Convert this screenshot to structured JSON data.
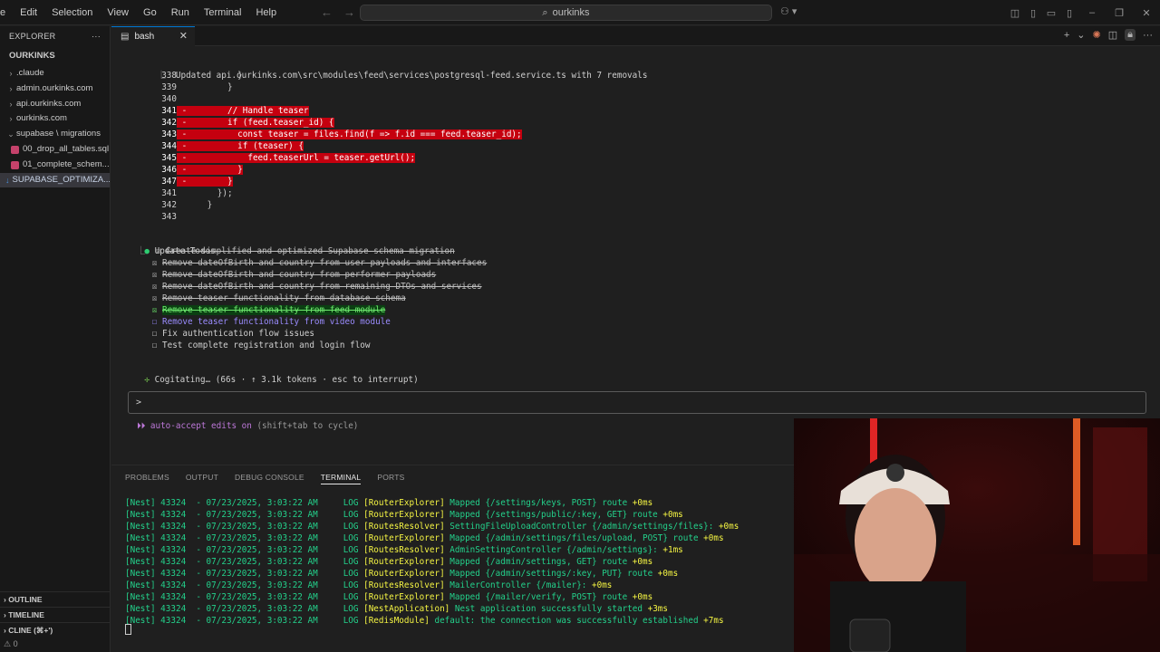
{
  "menu": [
    "e",
    "Edit",
    "Selection",
    "View",
    "Go",
    "Run",
    "Terminal",
    "Help"
  ],
  "search": {
    "text": "ourkinks"
  },
  "sidebar": {
    "title": "EXPLORER",
    "root": "OURKINKS",
    "items": [
      {
        "label": ".claude",
        "type": "folder"
      },
      {
        "label": "admin.ourkinks.com",
        "type": "folder"
      },
      {
        "label": "api.ourkinks.com",
        "type": "folder"
      },
      {
        "label": "ourkinks.com",
        "type": "folder"
      },
      {
        "label": "supabase \\ migrations",
        "type": "folder-open"
      },
      {
        "label": "00_drop_all_tables.sql",
        "type": "file"
      },
      {
        "label": "01_complete_schem...",
        "type": "file"
      },
      {
        "label": "SUPABASE_OPTIMIZA...",
        "type": "file-selected"
      }
    ],
    "outline": "OUTLINE",
    "timeline": "TIMELINE",
    "cline": "CLINE (⌘+')",
    "status": "⚠ 0"
  },
  "tab": {
    "label": "bash"
  },
  "editor": {
    "update_line": "Updated api.ourkinks.com\\src\\modules\\feed\\services\\postgresql-feed.service.ts with 7 removals",
    "code": [
      {
        "n": "338",
        "code": "        }",
        "del": false
      },
      {
        "n": "339",
        "code": "      }",
        "del": false
      },
      {
        "n": "340",
        "code": "",
        "del": false
      },
      {
        "n": "341",
        "code": "      // Handle teaser",
        "del": true
      },
      {
        "n": "342",
        "code": "      if (feed.teaser_id) {",
        "del": true
      },
      {
        "n": "343",
        "code": "        const teaser = files.find(f => f.id === feed.teaser_id);",
        "del": true
      },
      {
        "n": "344",
        "code": "        if (teaser) {",
        "del": true
      },
      {
        "n": "345",
        "code": "          feed.teaserUrl = teaser.getUrl();",
        "del": true
      },
      {
        "n": "346",
        "code": "        }",
        "del": true
      },
      {
        "n": "347",
        "code": "      }",
        "del": true
      },
      {
        "n": "341",
        "code": "    });",
        "del": false
      },
      {
        "n": "342",
        "code": "  }",
        "del": false
      },
      {
        "n": "343",
        "code": "",
        "del": false
      }
    ],
    "todos_title": "Update Todos",
    "todos": [
      {
        "text": "Create simplified and optimized Supabase schema migration",
        "state": "done"
      },
      {
        "text": "Remove dateOfBirth and country from user payloads and interfaces",
        "state": "done"
      },
      {
        "text": "Remove dateOfBirth and country from performer payloads",
        "state": "done"
      },
      {
        "text": "Remove dateOfBirth and country from remaining DTOs and services",
        "state": "done"
      },
      {
        "text": "Remove teaser functionality from database schema",
        "state": "done"
      },
      {
        "text": "Remove teaser functionality from feed module",
        "state": "just-done"
      },
      {
        "text": "Remove teaser functionality from video module",
        "state": "in-progress"
      },
      {
        "text": "Fix authentication flow issues",
        "state": "pending"
      },
      {
        "text": "Test complete registration and login flow",
        "state": "pending"
      }
    ],
    "cogitating": "Cogitating… (66s · ↑ 3.1k tokens · esc to interrupt)",
    "prompt_symbol": ">",
    "auto_accept": "⏵⏵ auto-accept edits on",
    "auto_accept_hint": "(shift+tab to cycle)"
  },
  "panel": {
    "tabs": [
      "PROBLEMS",
      "OUTPUT",
      "DEBUG CONSOLE",
      "TERMINAL",
      "PORTS"
    ],
    "active_tab": "TERMINAL",
    "logs": [
      {
        "ctx": "[RouterExplorer]",
        "msg": "Mapped {/settings/keys, POST} route",
        "t": "+0ms"
      },
      {
        "ctx": "[RouterExplorer]",
        "msg": "Mapped {/settings/public/:key, GET} route",
        "t": "+0ms"
      },
      {
        "ctx": "[RoutesResolver]",
        "msg": "SettingFileUploadController {/admin/settings/files}:",
        "t": "+0ms"
      },
      {
        "ctx": "[RouterExplorer]",
        "msg": "Mapped {/admin/settings/files/upload, POST} route",
        "t": "+0ms"
      },
      {
        "ctx": "[RoutesResolver]",
        "msg": "AdminSettingController {/admin/settings}:",
        "t": "+1ms"
      },
      {
        "ctx": "[RouterExplorer]",
        "msg": "Mapped {/admin/settings, GET} route",
        "t": "+0ms"
      },
      {
        "ctx": "[RouterExplorer]",
        "msg": "Mapped {/admin/settings/:key, PUT} route",
        "t": "+0ms"
      },
      {
        "ctx": "[RoutesResolver]",
        "msg": "MailerController {/mailer}:",
        "t": "+0ms"
      },
      {
        "ctx": "[RouterExplorer]",
        "msg": "Mapped {/mailer/verify, POST} route",
        "t": "+0ms"
      },
      {
        "ctx": "[NestApplication]",
        "msg": "Nest application successfully started",
        "t": "+3ms"
      },
      {
        "ctx": "[RedisModule]",
        "msg": "default: the connection was successfully established",
        "t": "+7ms"
      }
    ],
    "log_prefix": "[Nest] 43324  - 07/23/2025, 3:03:22 AM",
    "log_level": "LOG"
  }
}
